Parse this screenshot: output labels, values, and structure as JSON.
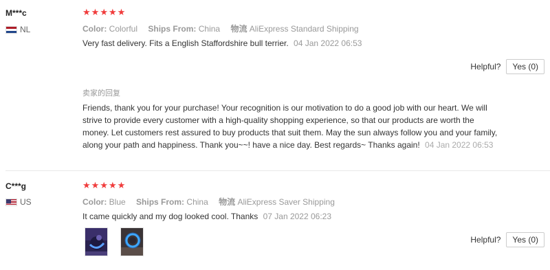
{
  "reviews": [
    {
      "user": "M***c",
      "country_code": "NL",
      "flag_colors": [
        "#ae1c28",
        "#ffffff",
        "#21468b"
      ],
      "stars": 5,
      "meta": {
        "color_label": "Color:",
        "color_value": "Colorful",
        "ships_label": "Ships From:",
        "ships_value": "China",
        "logistics_label": "物流",
        "logistics_value": "AliExpress Standard Shipping"
      },
      "text": "Very fast delivery. Fits a English Staffordshire bull terrier.",
      "date": "04 Jan 2022 06:53",
      "helpful_label": "Helpful?",
      "yes_label": "Yes (0)",
      "seller_reply": {
        "heading": "卖家的回复",
        "text": "Friends, thank you for your purchase! Your recognition is our motivation to do a good job with our heart. We will strive to provide every customer with a high-quality shopping experience, so that our products are worth the money. Let customers rest assured to buy products that suit them. May the sun always follow you and your family, along your path and happiness. Thank you~~! have a nice day. Best regards~ Thanks again!",
        "date": "04 Jan 2022 06:53"
      }
    },
    {
      "user": "C***g",
      "country_code": "US",
      "flag_colors": [
        "#b22234",
        "#ffffff",
        "#3c3b6e"
      ],
      "stars": 5,
      "meta": {
        "color_label": "Color:",
        "color_value": "Blue",
        "ships_label": "Ships From:",
        "ships_value": "China",
        "logistics_label": "物流",
        "logistics_value": "AliExpress Saver Shipping"
      },
      "text": "It came quickly and my dog looked cool. Thanks",
      "date": "07 Jan 2022 06:23",
      "helpful_label": "Helpful?",
      "yes_label": "Yes (0)",
      "photos": [
        "review-photo-glowing-collar-1",
        "review-photo-glowing-collar-2"
      ]
    }
  ],
  "star_char": "★"
}
